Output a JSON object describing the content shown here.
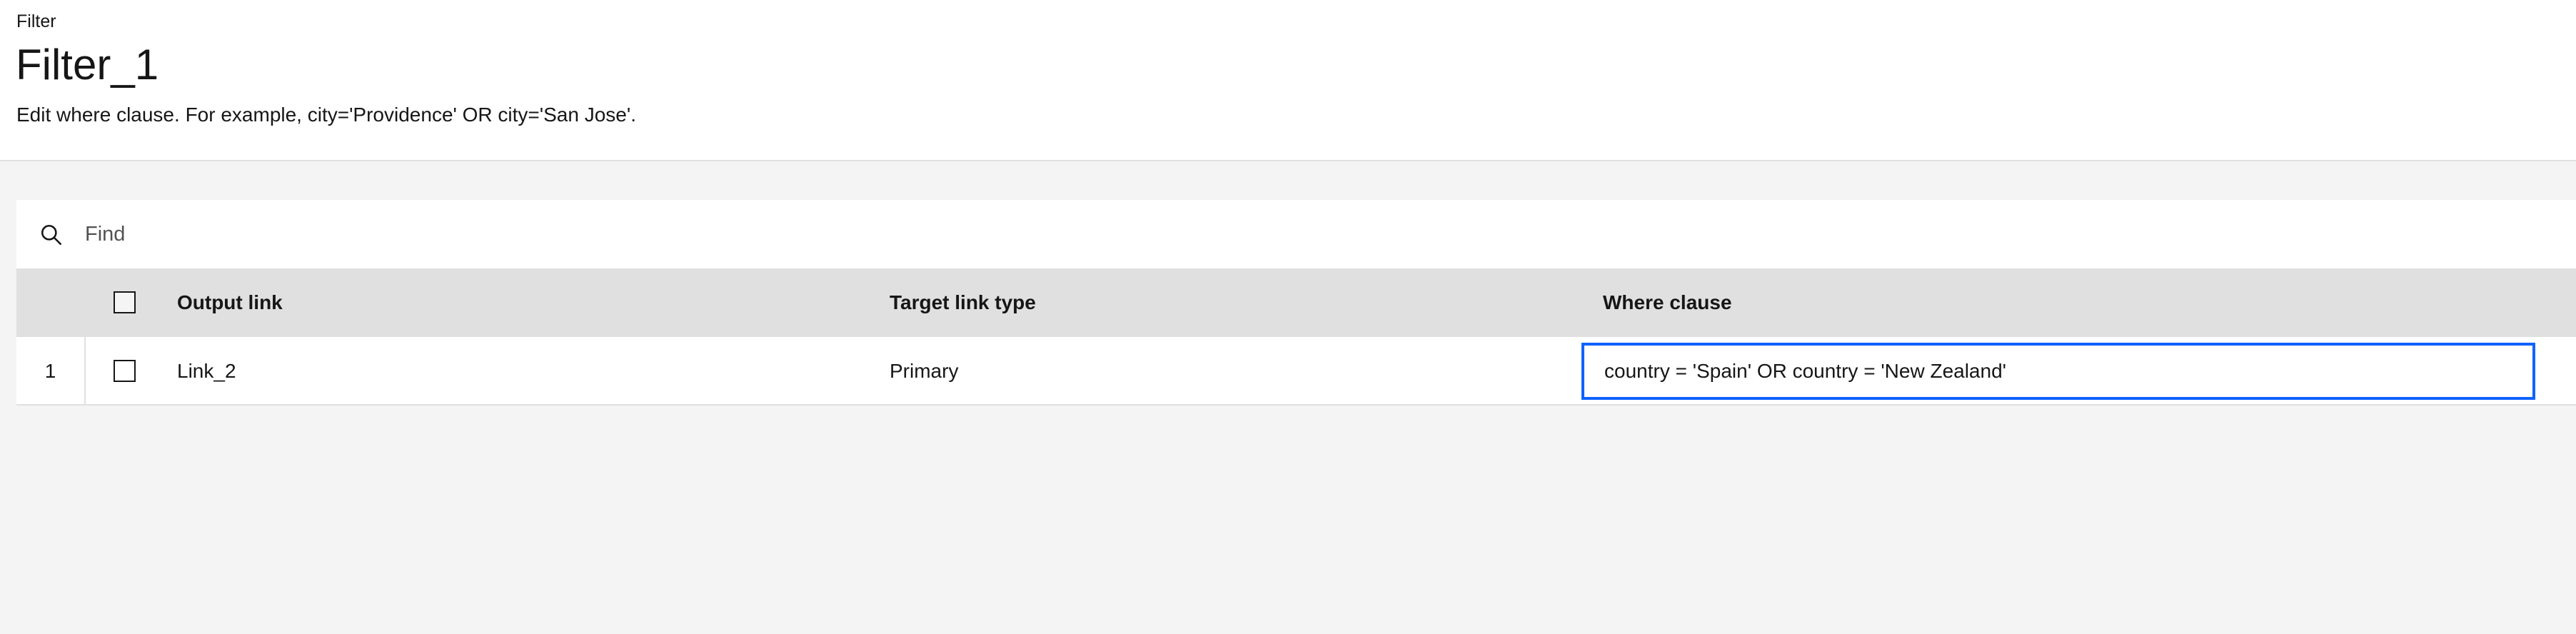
{
  "header": {
    "breadcrumb": "Filter",
    "title": "Filter_1",
    "description": "Edit where clause. For example, city='Providence' OR city='San Jose'."
  },
  "search": {
    "placeholder": "Find",
    "value": "",
    "icon": "search-icon"
  },
  "table": {
    "columns": [
      "Output link",
      "Target link type",
      "Where clause"
    ],
    "rows": [
      {
        "number": "1",
        "selected": false,
        "output_link": "Link_2",
        "target_link_type": "Primary",
        "where_clause": "country = 'Spain' OR country = 'New Zealand'"
      }
    ]
  },
  "colors": {
    "background": "#f4f4f4",
    "header_row": "#e0e0e0",
    "focus": "#0f62fe",
    "text": "#161616"
  }
}
